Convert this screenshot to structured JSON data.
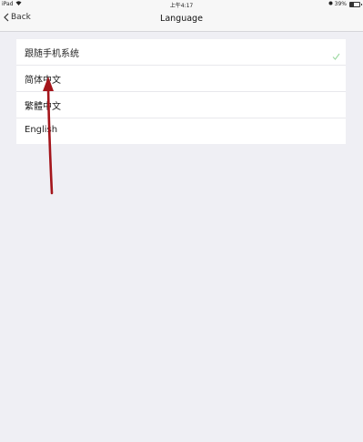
{
  "status_bar": {
    "device": "iPad",
    "time": "上午4:17",
    "battery": "39%",
    "battery_level": 0.39
  },
  "nav": {
    "back_label": "Back",
    "title": "Language"
  },
  "languages": [
    {
      "label": "跟随手机系统",
      "selected": true
    },
    {
      "label": "简体中文",
      "selected": false
    },
    {
      "label": "繁體中文",
      "selected": false
    },
    {
      "label": "English",
      "selected": false
    }
  ],
  "colors": {
    "background": "#efeff4",
    "checkmark": "#9bd8a0",
    "annotation_arrow": "#a4151b"
  }
}
